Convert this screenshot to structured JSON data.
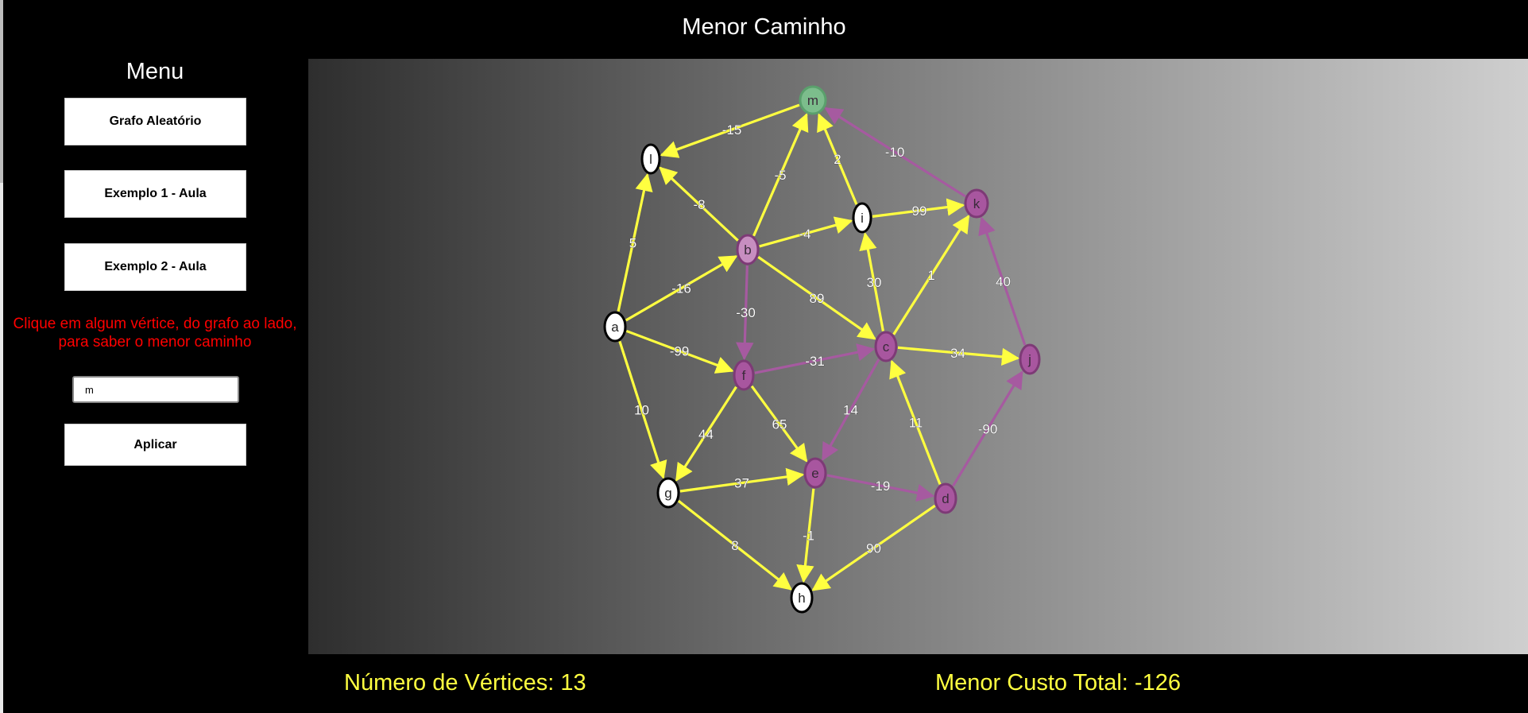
{
  "app": {
    "title": "Menor Caminho"
  },
  "menu": {
    "title": "Menu",
    "buttons": {
      "random": "Grafo Aleatório",
      "example1": "Exemplo 1 - Aula",
      "example2": "Exemplo 2 - Aula",
      "apply": "Aplicar"
    },
    "hint_line1": "Clique em algum vértice, do grafo ao lado,",
    "hint_line2": "para saber o menor caminho",
    "vertex_input_value": "m"
  },
  "footer": {
    "vertex_count": "Número de Vértices: 13",
    "total_cost": "Menor Custo Total: -126"
  },
  "colors": {
    "yellow_edge": "#ffff40",
    "purple_edge": "#a65aa0",
    "purple_node": "#a8569f",
    "light_purple_node": "#c78ec0",
    "green_node": "#7cbd8c",
    "white_node": "#ffffff",
    "hint": "#ff0000",
    "footer_text": "#ffff40"
  },
  "graph": {
    "nodes": [
      {
        "id": "a",
        "state": "default"
      },
      {
        "id": "b",
        "state": "source"
      },
      {
        "id": "c",
        "state": "path"
      },
      {
        "id": "d",
        "state": "path"
      },
      {
        "id": "e",
        "state": "path"
      },
      {
        "id": "f",
        "state": "path"
      },
      {
        "id": "g",
        "state": "default"
      },
      {
        "id": "h",
        "state": "default"
      },
      {
        "id": "i",
        "state": "default"
      },
      {
        "id": "j",
        "state": "path"
      },
      {
        "id": "k",
        "state": "path"
      },
      {
        "id": "l",
        "state": "default"
      },
      {
        "id": "m",
        "state": "target"
      }
    ],
    "edges": [
      {
        "from": "m",
        "to": "l",
        "weight": "-15",
        "highlight": false
      },
      {
        "from": "b",
        "to": "l",
        "weight": "-8",
        "highlight": false
      },
      {
        "from": "b",
        "to": "m",
        "weight": "-5",
        "highlight": false
      },
      {
        "from": "i",
        "to": "m",
        "weight": "2",
        "highlight": false
      },
      {
        "from": "k",
        "to": "m",
        "weight": "-10",
        "highlight": true
      },
      {
        "from": "b",
        "to": "i",
        "weight": "-4",
        "highlight": false
      },
      {
        "from": "i",
        "to": "k",
        "weight": "99",
        "highlight": false
      },
      {
        "from": "a",
        "to": "l",
        "weight": "5",
        "highlight": false
      },
      {
        "from": "a",
        "to": "b",
        "weight": "-16",
        "highlight": false
      },
      {
        "from": "b",
        "to": "f",
        "weight": "-30",
        "highlight": true
      },
      {
        "from": "b",
        "to": "c",
        "weight": "89",
        "highlight": false
      },
      {
        "from": "c",
        "to": "i",
        "weight": "30",
        "highlight": false
      },
      {
        "from": "c",
        "to": "k",
        "weight": "1",
        "highlight": false
      },
      {
        "from": "j",
        "to": "k",
        "weight": "40",
        "highlight": true
      },
      {
        "from": "a",
        "to": "f",
        "weight": "-99",
        "highlight": false
      },
      {
        "from": "f",
        "to": "c",
        "weight": "-31",
        "highlight": true
      },
      {
        "from": "c",
        "to": "j",
        "weight": "34",
        "highlight": false
      },
      {
        "from": "a",
        "to": "g",
        "weight": "10",
        "highlight": false
      },
      {
        "from": "f",
        "to": "g",
        "weight": "44",
        "highlight": false
      },
      {
        "from": "f",
        "to": "e",
        "weight": "65",
        "highlight": false
      },
      {
        "from": "c",
        "to": "e",
        "weight": "14",
        "highlight": true
      },
      {
        "from": "d",
        "to": "c",
        "weight": "11",
        "highlight": false
      },
      {
        "from": "d",
        "to": "j",
        "weight": "-90",
        "highlight": true
      },
      {
        "from": "g",
        "to": "e",
        "weight": "37",
        "highlight": false
      },
      {
        "from": "e",
        "to": "d",
        "weight": "-19",
        "highlight": true
      },
      {
        "from": "e",
        "to": "h",
        "weight": "-1",
        "highlight": false
      },
      {
        "from": "g",
        "to": "h",
        "weight": "8",
        "highlight": false
      },
      {
        "from": "d",
        "to": "h",
        "weight": "90",
        "highlight": false
      }
    ]
  }
}
